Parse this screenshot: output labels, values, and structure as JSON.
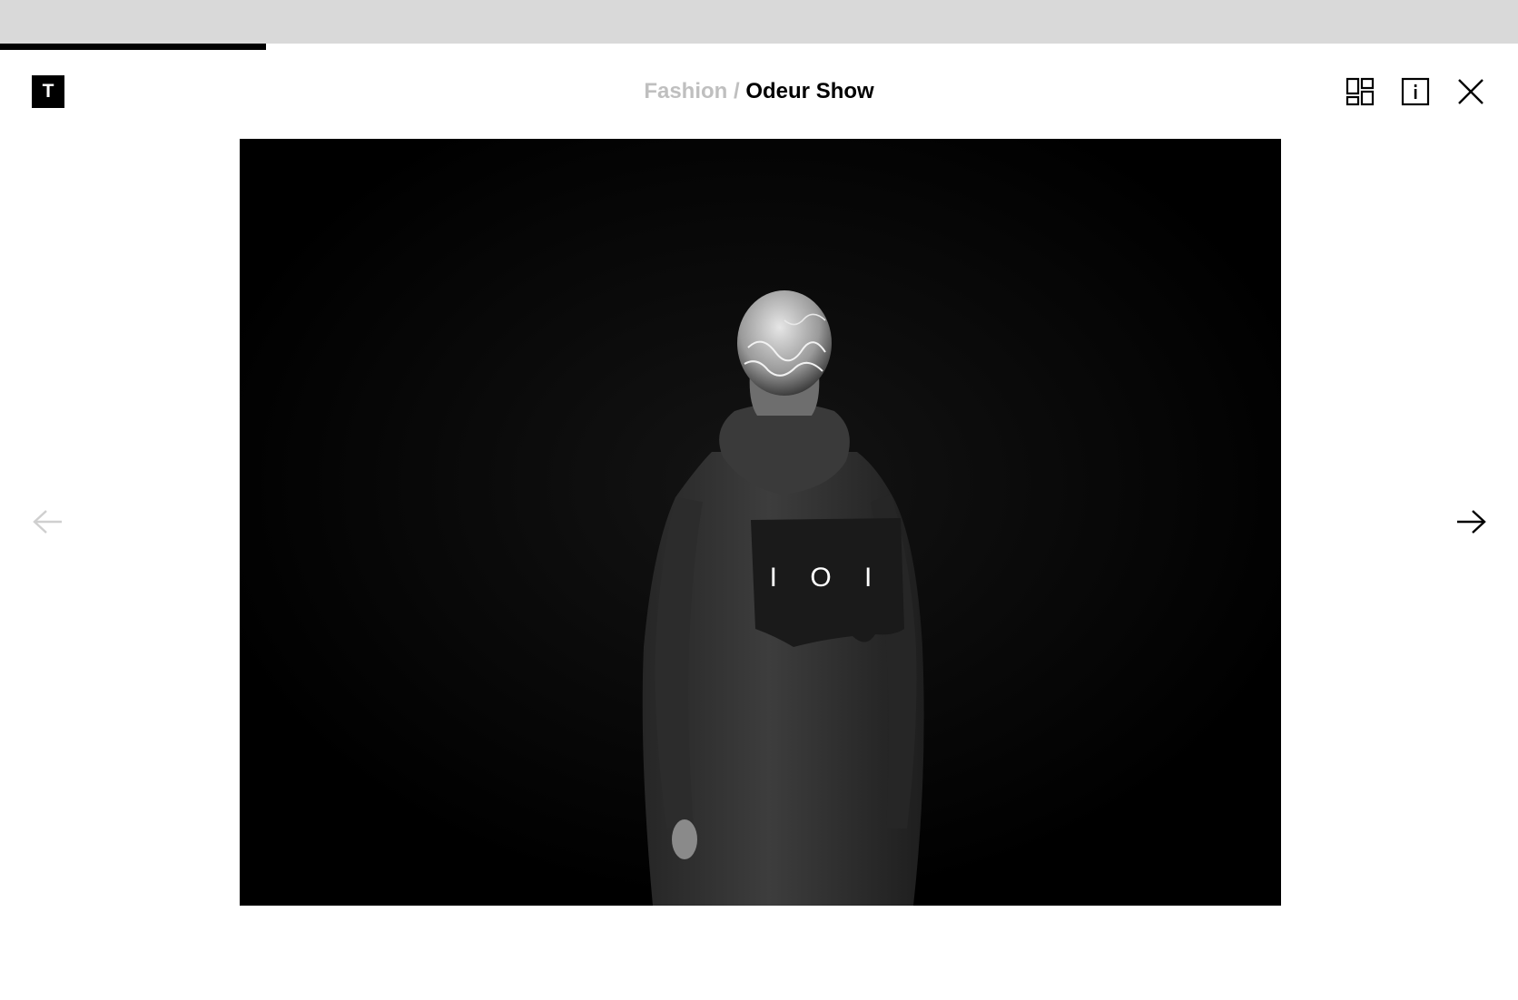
{
  "header": {
    "logo_letter": "T",
    "breadcrumb": {
      "category": "Fashion",
      "separator": " / ",
      "title": "Odeur Show"
    },
    "toolbar": {
      "grid_icon": "grid-icon",
      "info_icon": "info-icon",
      "close_icon": "close-icon"
    }
  },
  "slideshow": {
    "progress_fraction": 0.175,
    "prev_icon": "arrow-left-icon",
    "next_icon": "arrow-right-icon",
    "prev_enabled": false,
    "next_enabled": true,
    "photo": {
      "patch_text": "I O I"
    }
  },
  "colors": {
    "top_bar": "#d9d9d9",
    "progress": "#000000",
    "accent": "#000000",
    "muted": "#bfbfbf"
  }
}
